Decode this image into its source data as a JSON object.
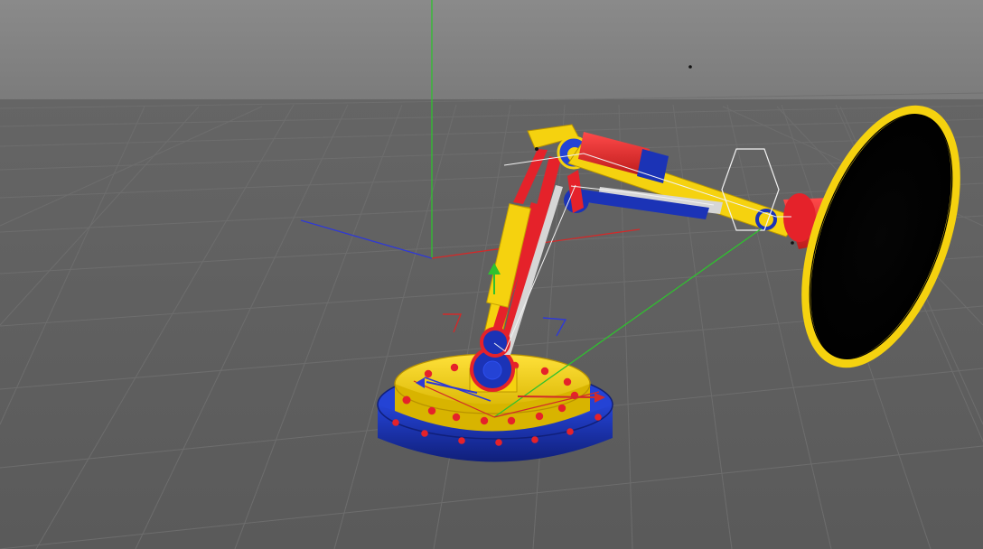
{
  "app": {
    "view": "perspective-viewport"
  },
  "colors": {
    "sky_top": "#8c8c8c",
    "sky_bottom": "#7a7a7a",
    "floor": "#5f5f5f",
    "grid_line": "#6d6d6d",
    "red": "#e5222a",
    "yellow": "#f5d20f",
    "blue": "#1b33b6",
    "dark_blue": "#142486",
    "black": "#000000",
    "light_gray": "#d6d6d6",
    "axis_x": "#d12a2a",
    "axis_y": "#2fc12f",
    "axis_z": "#2f39d6",
    "helper_white": "#f2f2f2"
  },
  "objects": {
    "base_plate_label": "",
    "arm_label": "",
    "disc_label": ""
  }
}
